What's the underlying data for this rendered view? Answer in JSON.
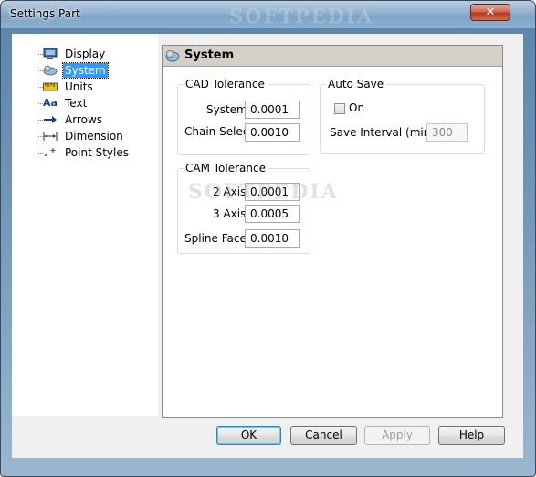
{
  "window": {
    "title": "Settings Part",
    "close_glyph": "✕"
  },
  "watermark": {
    "text": "SOFTPEDIA"
  },
  "tree": {
    "items": [
      {
        "label": "Display",
        "icon": "display-icon"
      },
      {
        "label": "System",
        "icon": "system-icon",
        "selected": true
      },
      {
        "label": "Units",
        "icon": "units-icon"
      },
      {
        "label": "Text",
        "icon": "text-icon",
        "glyph": "Aa"
      },
      {
        "label": "Arrows",
        "icon": "arrows-icon"
      },
      {
        "label": "Dimension",
        "icon": "dimension-icon"
      },
      {
        "label": "Point Styles",
        "icon": "point-styles-icon"
      }
    ]
  },
  "panel": {
    "title": "System",
    "cad_tolerance": {
      "title": "CAD Tolerance",
      "system_label": "System",
      "system_value": "0.0001",
      "chain_select_label": "Chain Select",
      "chain_select_value": "0.0010"
    },
    "auto_save": {
      "title": "Auto Save",
      "on_label": "On",
      "on_checked": false,
      "interval_label": "Save Interval (min.)",
      "interval_value": "300"
    },
    "cam_tolerance": {
      "title": "CAM Tolerance",
      "axis2_label": "2 Axis",
      "axis2_value": "0.0001",
      "axis3_label": "3 Axis",
      "axis3_value": "0.0005",
      "spline_label": "Spline Facet",
      "spline_value": "0.0010"
    }
  },
  "buttons": {
    "ok": "OK",
    "cancel": "Cancel",
    "apply": "Apply",
    "help": "Help"
  },
  "colors": {
    "selection": "#3399ff",
    "title_gradient_top": "#b9cde0",
    "close_red": "#c8452c"
  }
}
